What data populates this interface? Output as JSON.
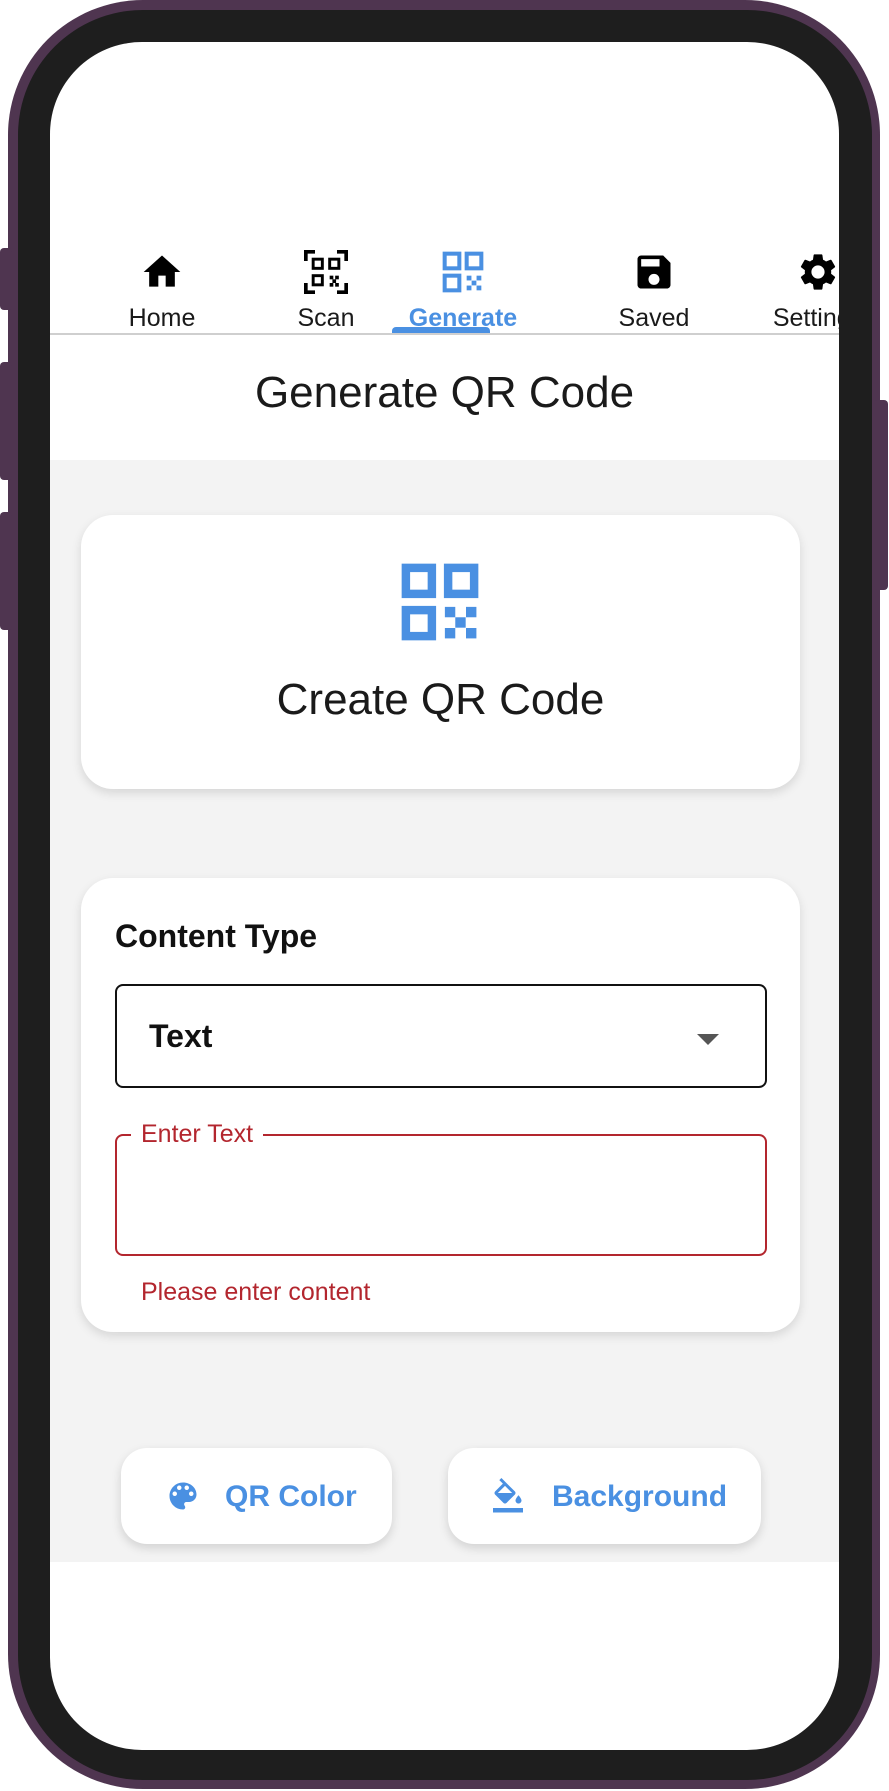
{
  "nav": {
    "items": [
      {
        "label": "Home",
        "icon": "home-icon"
      },
      {
        "label": "Scan",
        "icon": "qr-scan-icon"
      },
      {
        "label": "Generate",
        "icon": "qr-code-icon"
      },
      {
        "label": "Saved",
        "icon": "save-icon"
      },
      {
        "label": "Settings",
        "icon": "gear-icon"
      }
    ],
    "active": "Generate"
  },
  "page": {
    "title": "Generate QR Code"
  },
  "hero": {
    "title": "Create QR Code",
    "icon": "qr-code-icon"
  },
  "form": {
    "content_type_label": "Content Type",
    "content_type_value": "Text",
    "text_field_label": "Enter Text",
    "text_field_value": "",
    "error_message": "Please enter content"
  },
  "actions": {
    "qr_color_label": "QR Color",
    "qr_color_icon": "palette-icon",
    "background_label": "Background",
    "background_icon": "paint-bucket-icon"
  },
  "colors": {
    "accent": "#4a90e2",
    "error": "#b3262e",
    "frame": "#4f3550",
    "content_background": "#f3f3f3"
  }
}
